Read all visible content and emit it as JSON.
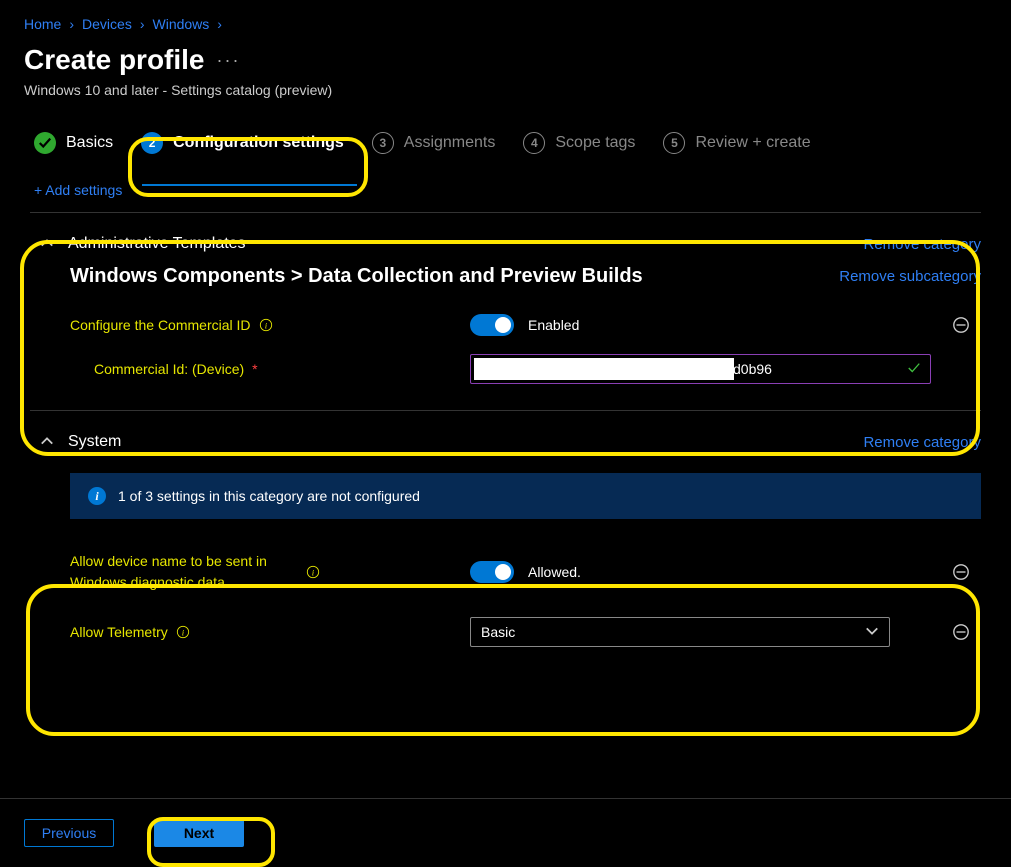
{
  "breadcrumb": [
    {
      "label": "Home"
    },
    {
      "label": "Devices"
    },
    {
      "label": "Windows"
    }
  ],
  "page": {
    "title": "Create profile",
    "subtitle": "Windows 10 and later - Settings catalog (preview)"
  },
  "steps": [
    {
      "label": "Basics",
      "state": "done"
    },
    {
      "label": "Configuration settings",
      "state": "active",
      "num": "2"
    },
    {
      "label": "Assignments",
      "state": "pending",
      "num": "3"
    },
    {
      "label": "Scope tags",
      "state": "pending",
      "num": "4"
    },
    {
      "label": "Review + create",
      "state": "pending",
      "num": "5"
    }
  ],
  "actions": {
    "add_settings": "+ Add settings",
    "remove_category": "Remove category",
    "remove_subcategory": "Remove subcategory"
  },
  "admin": {
    "category": "Administrative Templates",
    "subcategory": "Windows Components > Data Collection and Preview Builds",
    "setting1_label": "Configure the Commercial ID",
    "setting1_state": "Enabled",
    "setting2_label": "Commercial Id: (Device)",
    "setting2_required": "*",
    "setting2_value_suffix": "d0b96"
  },
  "system": {
    "category": "System",
    "banner": "1 of 3 settings in this category are not configured",
    "setting1_label": "Allow device name to be sent in Windows diagnostic data",
    "setting1_state": "Allowed.",
    "setting2_label": "Allow Telemetry",
    "setting2_value": "Basic"
  },
  "footer": {
    "previous": "Previous",
    "next": "Next"
  }
}
